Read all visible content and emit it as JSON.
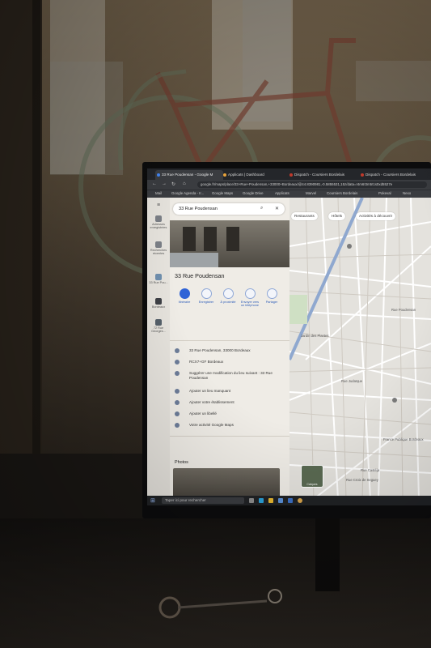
{
  "browser": {
    "tabs": [
      {
        "label": "33 Rue Poudensan - Google M",
        "active": true,
        "color": "#4285f4"
      },
      {
        "label": "Applicats | Dashboard",
        "active": false,
        "color": "#e8a33b"
      },
      {
        "label": "Dispatch - Coursiers Bordelais",
        "active": false,
        "color": "#c0392b"
      },
      {
        "label": "Dispatch - Coursiers Bordelais",
        "active": false,
        "color": "#c0392b"
      }
    ],
    "address": "google.fr/maps/place/33+Rue+Poudensan,+33000+Bordeaux/@44.8390981,-0.5855531,15z/data=!4m6!3m5!1s0xd5527e",
    "bookmarks": [
      "Mail",
      "Google Agenda - Ir...",
      "Google Maps",
      "Google Drive",
      "Applicats",
      "Marvel",
      "Coursiers Bordelais",
      "Pokeval",
      "Nexo"
    ]
  },
  "rail": {
    "items": [
      {
        "icon": "bookmark-icon",
        "label": "Adresses enregistrées"
      },
      {
        "icon": "history-icon",
        "label": "Recherches récentes"
      },
      {
        "icon": "place-icon",
        "label": "33 Rue Pou..."
      },
      {
        "icon": "place-icon",
        "label": "Bordeaux"
      },
      {
        "icon": "place-icon",
        "label": "72 Rue Georges..."
      }
    ]
  },
  "panel": {
    "search_value": "33 Rue Poudensan",
    "place_title": "33 Rue Poudensan",
    "actions": [
      {
        "icon": "directions-icon",
        "label": "Itinéraire"
      },
      {
        "icon": "save-icon",
        "label": "Enregistrer"
      },
      {
        "icon": "nearby-icon",
        "label": "À proximité"
      },
      {
        "icon": "phone-icon",
        "label": "Envoyer vers un téléphone"
      },
      {
        "icon": "share-icon",
        "label": "Partager"
      }
    ],
    "info": [
      {
        "icon": "pin-icon",
        "text": "33 Rue Poudensan, 33000 Bordeaux"
      },
      {
        "icon": "plus-code-icon",
        "text": "RCX7+GF Bordeaux"
      },
      {
        "icon": "edit-icon",
        "text": "Suggérer une modification du lieu suivant : 33 Rue Poudensan"
      },
      {
        "icon": "add-place-icon",
        "text": "Ajouter un lieu manquant"
      },
      {
        "icon": "business-icon",
        "text": "Ajouter votre établissement"
      },
      {
        "icon": "label-icon",
        "text": "Ajouter un libellé"
      },
      {
        "icon": "activity-icon",
        "text": "Votre activité Google Maps"
      }
    ],
    "photos_label": "Photos"
  },
  "map": {
    "chips": [
      {
        "icon": "restaurant-icon",
        "label": "Restaurants"
      },
      {
        "icon": "hotel-icon",
        "label": "Hôtels"
      },
      {
        "icon": "activities-icon",
        "label": "Activités à découvrir"
      }
    ],
    "labels": [
      {
        "text": "Jardin des Plantes"
      },
      {
        "text": "Rue Poudensan"
      },
      {
        "text": "France Publique Bordeaux"
      },
      {
        "text": "Rue Castéja"
      },
      {
        "text": "Rue Croix de Seguey"
      },
      {
        "text": "Rue Judaïque"
      }
    ],
    "layers_label": "Calques"
  },
  "taskbar": {
    "search_placeholder": "Taper ici pour rechercher"
  },
  "colors": {
    "accent": "#2f63d6",
    "map_road": "#ffffff",
    "map_highway": "#8fa8cf"
  }
}
